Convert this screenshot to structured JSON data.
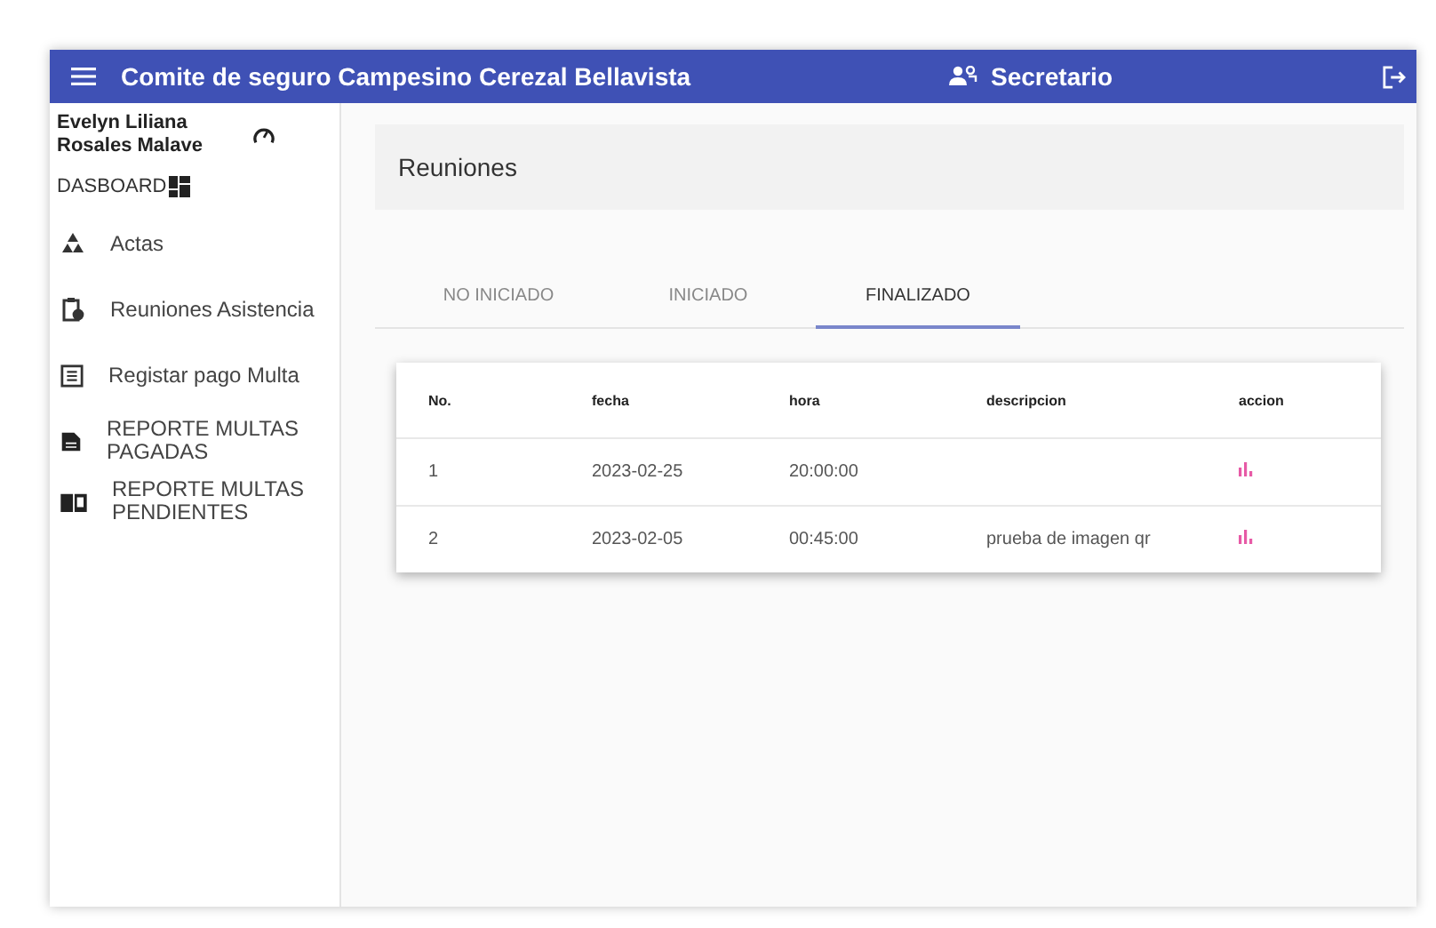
{
  "app_bar": {
    "title": "Comite de seguro Campesino Cerezal Bellavista",
    "role": "Secretario"
  },
  "sidebar": {
    "user": "Evelyn Liliana Rosales Malave",
    "dashboard": "DASBOARD",
    "items": [
      {
        "label": "Actas"
      },
      {
        "label": "Reuniones Asistencia"
      },
      {
        "label": "Registar pago Multa"
      },
      {
        "label": "REPORTE MULTAS PAGADAS"
      },
      {
        "label": "REPORTE MULTAS PENDIENTES"
      }
    ]
  },
  "page_title": "Reuniones",
  "tabs": [
    {
      "label": "NO INICIADO",
      "selected": false
    },
    {
      "label": "INICIADO",
      "selected": false
    },
    {
      "label": "FINALIZADO",
      "selected": true
    }
  ],
  "table": {
    "columns": [
      "No.",
      "fecha",
      "hora",
      "descripcion",
      "accion"
    ],
    "rows": [
      [
        "1",
        "2023-02-25",
        "20:00:00",
        ""
      ],
      [
        "2",
        "2023-02-05",
        "00:45:00",
        "prueba de imagen qr"
      ]
    ]
  }
}
